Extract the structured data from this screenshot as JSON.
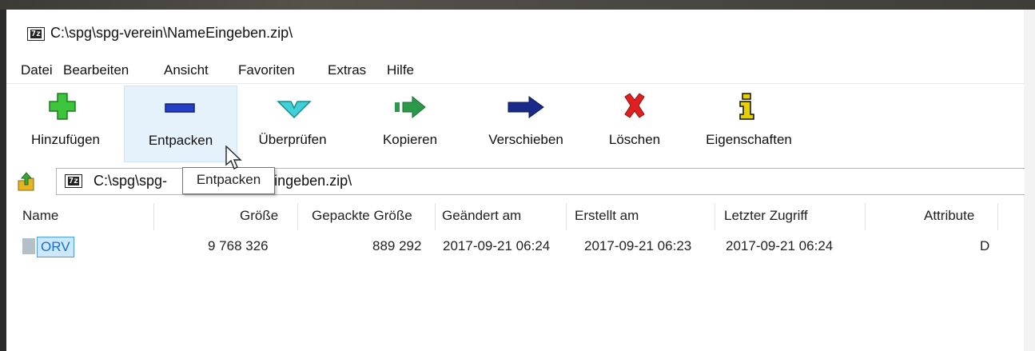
{
  "window": {
    "title": "C:\\spg\\spg-verein\\NameEingeben.zip\\",
    "app_icon_label": "7z"
  },
  "menu": [
    "Datei",
    "Bearbeiten",
    "Ansicht",
    "Favoriten",
    "Extras",
    "Hilfe"
  ],
  "toolbar": {
    "add": "Hinzufügen",
    "extract": "Entpacken",
    "test": "Überprüfen",
    "copy": "Kopieren",
    "move": "Verschieben",
    "delete": "Löschen",
    "info": "Eigenschaften"
  },
  "address": {
    "before_tooltip": "C:\\spg\\spg-",
    "after_tooltip": "eEingeben.zip\\"
  },
  "tooltip": "Entpacken",
  "columns": [
    "Name",
    "Größe",
    "Gepackte Größe",
    "Geändert am",
    "Erstellt am",
    "Letzter Zugriff",
    "Attribute"
  ],
  "rows": [
    {
      "name": "ORV",
      "size": "9 768 326",
      "packed": "889 292",
      "modified": "2017-09-21 06:24",
      "created": "2017-09-21 06:23",
      "accessed": "2017-09-21 06:24",
      "attr": "D"
    }
  ],
  "colors": {
    "hover_bg": "#e5f1fb",
    "selection_bg": "#cce8ff",
    "selection_border": "#4a9eea"
  }
}
